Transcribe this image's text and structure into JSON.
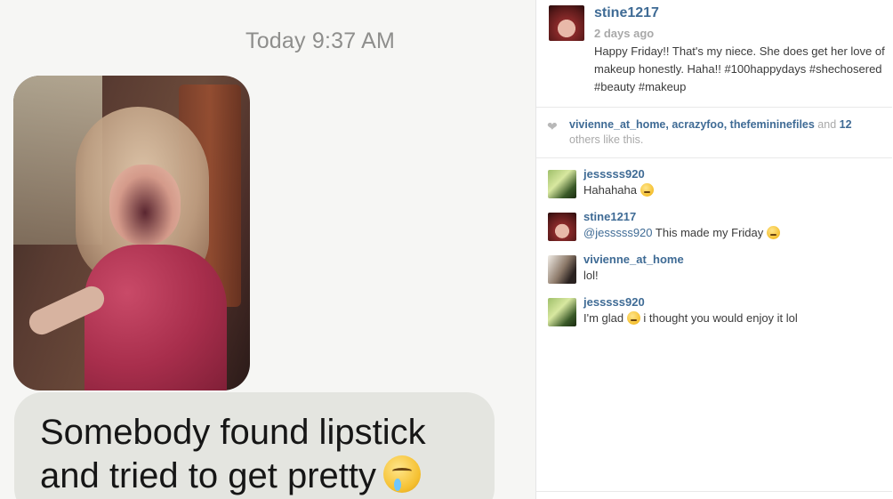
{
  "message": {
    "timestamp": "Today 9:37 AM",
    "bubble_text": "Somebody found lipstick\nand tried to get pretty"
  },
  "post": {
    "username": "stine1217",
    "time_ago": "2 days ago",
    "caption": "Happy Friday!! That's my niece. She does get her love of makeup honestly. Haha!! #100happydays #shechosered #beauty #makeup"
  },
  "likes": {
    "users": [
      "vivienne_at_home",
      "acrazyfoo",
      "thefemininefiles"
    ],
    "sep1": ", ",
    "sep2": ", ",
    "and_text": " and ",
    "others_count": "12",
    "suffix": " others like this."
  },
  "comments": [
    {
      "user": "jesssss920",
      "text": "Hahahaha",
      "emoji": "relieved-face"
    },
    {
      "user": "stine1217",
      "mention": "@jesssss920",
      "text": " This made my Friday ",
      "emoji": "kissing-face"
    },
    {
      "user": "vivienne_at_home",
      "text": "lol!"
    },
    {
      "user": "jesssss920",
      "text_before": "I'm glad ",
      "text_after": " i thought you would enjoy it lol",
      "emoji": "grinning-face"
    }
  ],
  "colors": {
    "link": "#3f6b95",
    "muted": "#a9a9a9",
    "bubble": "#e4e5e0"
  }
}
